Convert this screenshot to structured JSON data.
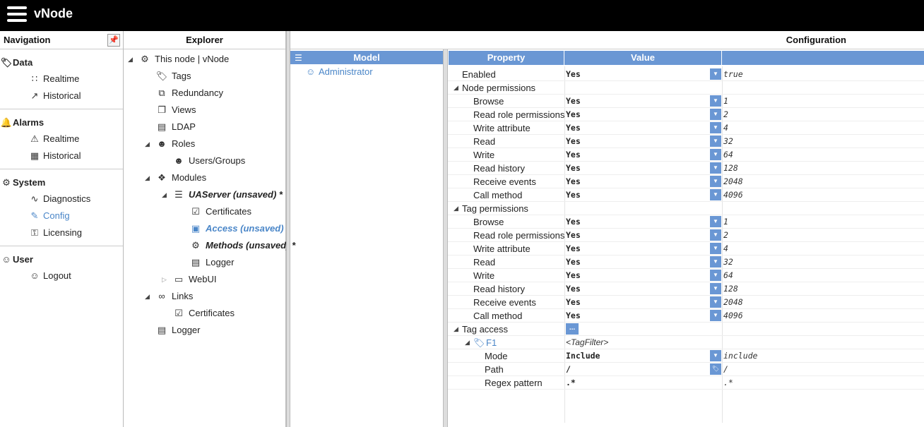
{
  "app": {
    "title": "vNode"
  },
  "nav": {
    "header": "Navigation",
    "sections": [
      {
        "title": "Data",
        "items": [
          "Realtime",
          "Historical"
        ]
      },
      {
        "title": "Alarms",
        "items": [
          "Realtime",
          "Historical"
        ]
      },
      {
        "title": "System",
        "items": [
          "Diagnostics",
          "Config",
          "Licensing"
        ]
      },
      {
        "title": "User",
        "items": [
          "Logout"
        ]
      }
    ]
  },
  "explorer": {
    "header": "Explorer",
    "nodes": [
      "This node | vNode",
      "Tags",
      "Redundancy",
      "Views",
      "LDAP",
      "Roles",
      "Users/Groups",
      "Modules",
      "UAServer (unsaved) *",
      "Certificates",
      "Access (unsaved) *",
      "Methods (unsaved) *",
      "Logger",
      "WebUI",
      "Links",
      "Certificates",
      "Logger"
    ]
  },
  "config": {
    "header": "Configuration",
    "model_header": "Model",
    "model_items": [
      "Administrator"
    ],
    "columns": {
      "property": "Property",
      "value": "Value"
    },
    "rows": [
      {
        "name": "Enabled",
        "value": "Yes",
        "raw": "true"
      },
      {
        "name": "Node permissions"
      },
      {
        "name": "Browse",
        "value": "Yes",
        "raw": "1"
      },
      {
        "name": "Read role permissions",
        "value": "Yes",
        "raw": "2"
      },
      {
        "name": "Write attribute",
        "value": "Yes",
        "raw": "4"
      },
      {
        "name": "Read",
        "value": "Yes",
        "raw": "32"
      },
      {
        "name": "Write",
        "value": "Yes",
        "raw": "64"
      },
      {
        "name": "Read history",
        "value": "Yes",
        "raw": "128"
      },
      {
        "name": "Receive events",
        "value": "Yes",
        "raw": "2048"
      },
      {
        "name": "Call method",
        "value": "Yes",
        "raw": "4096"
      },
      {
        "name": "Tag permissions"
      },
      {
        "name": "Browse",
        "value": "Yes",
        "raw": "1"
      },
      {
        "name": "Read role permissions",
        "value": "Yes",
        "raw": "2"
      },
      {
        "name": "Write attribute",
        "value": "Yes",
        "raw": "4"
      },
      {
        "name": "Read",
        "value": "Yes",
        "raw": "32"
      },
      {
        "name": "Write",
        "value": "Yes",
        "raw": "64"
      },
      {
        "name": "Read history",
        "value": "Yes",
        "raw": "128"
      },
      {
        "name": "Receive events",
        "value": "Yes",
        "raw": "2048"
      },
      {
        "name": "Call method",
        "value": "Yes",
        "raw": "4096"
      },
      {
        "name": "Tag access",
        "value": "..."
      },
      {
        "name": "F1",
        "value": "<TagFilter>"
      },
      {
        "name": "Mode",
        "value": "Include",
        "raw": "include"
      },
      {
        "name": "Path",
        "value": "/",
        "raw": "/"
      },
      {
        "name": "Regex pattern",
        "value": ".*",
        "raw": ".*"
      }
    ]
  },
  "colors": {
    "accent": "#6a97d4",
    "link": "#4a86c8",
    "topbar": "#000000"
  }
}
